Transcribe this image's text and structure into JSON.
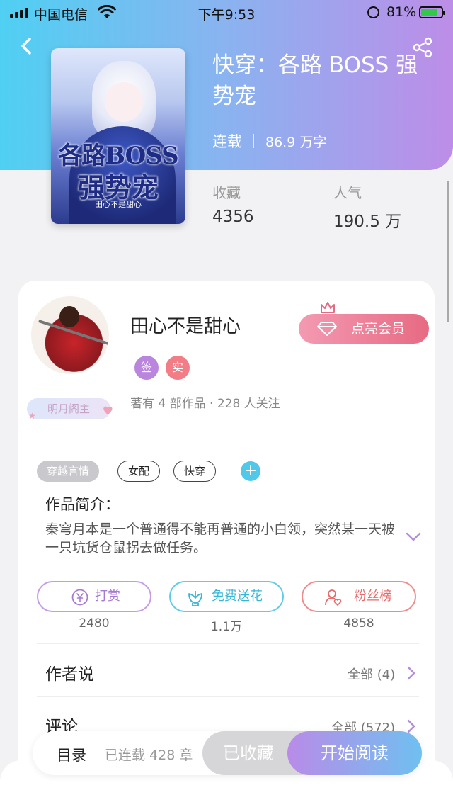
{
  "status_bar": {
    "carrier": "中国电信",
    "time": "下午9:53",
    "battery_pct": "81%",
    "battery_level": 0.81,
    "icons": [
      "signal-icon",
      "wifi-icon",
      "rotation-lock-icon",
      "battery-icon"
    ]
  },
  "header": {
    "back_icon": "back-arrow-icon",
    "share_icon": "share-icon"
  },
  "cover": {
    "line1": "各路BOSS",
    "line2": "强势宠",
    "line3": "田心不是甜心"
  },
  "book": {
    "title": "快穿：各路 BOSS 强势宠",
    "status": "连载",
    "word_count": "86.9 万字",
    "collect_label": "收藏",
    "collect_value": "4356",
    "popularity_label": "人气",
    "popularity_value": "190.5 万"
  },
  "author": {
    "name": "田心不是甜心",
    "badge": "明月阁主",
    "vip_button": "点亮会员",
    "tag_signed": "签",
    "tag_real": "实",
    "works_info": "著有 4 部作品 · 228 人关注"
  },
  "tags": [
    "穿越言情",
    "女配",
    "快穿"
  ],
  "intro": {
    "title": "作品简介：",
    "text": "秦穹月本是一个普通得不能再普通的小白领，突然某一天被一只坑货仓鼠拐去做任务。"
  },
  "actions": {
    "reward": {
      "label": "打赏",
      "count": "2480"
    },
    "flower": {
      "label": "免费送花",
      "count": "1.1万"
    },
    "fans": {
      "label": "粉丝榜",
      "count": "4858"
    }
  },
  "rows": {
    "author_says": {
      "title": "作者说",
      "more": "全部 (4)"
    },
    "comments": {
      "title": "评论",
      "more": "全部 (572)"
    }
  },
  "bottom": {
    "toc": "目录",
    "chapter_count": "已连载 428 章",
    "collected": "已收藏",
    "read": "开始阅读"
  },
  "colors": {
    "header_gradient_start": "#4fd0f2",
    "header_gradient_end": "#bd8de8",
    "vip": "#e76a83",
    "read_button_start": "#b98be8",
    "read_button_end": "#6fc0f0"
  }
}
